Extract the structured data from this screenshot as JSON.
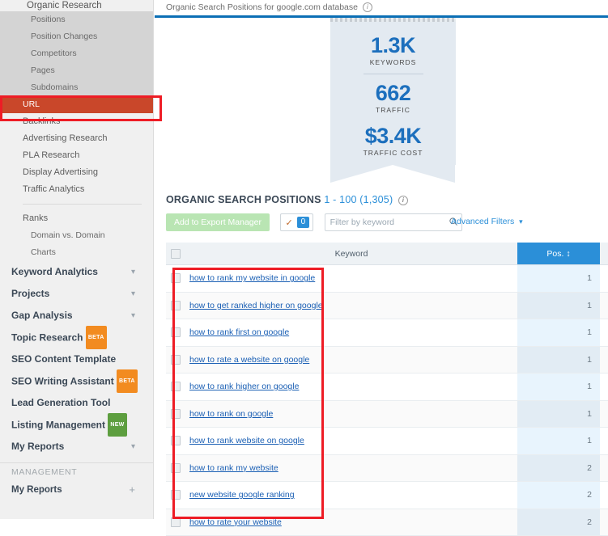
{
  "sidebar": {
    "top_item": "Organic Research",
    "submenu": [
      {
        "label": "Positions",
        "active": false
      },
      {
        "label": "Position Changes",
        "active": false
      },
      {
        "label": "Competitors",
        "active": false
      },
      {
        "label": "Pages",
        "active": false
      },
      {
        "label": "Subdomains",
        "active": false
      },
      {
        "label": "URL",
        "active": true
      }
    ],
    "items": [
      {
        "label": "Backlinks"
      },
      {
        "label": "Advertising Research"
      },
      {
        "label": "PLA Research"
      },
      {
        "label": "Display Advertising"
      },
      {
        "label": "Traffic Analytics"
      }
    ],
    "sub_items2": [
      {
        "label": "Ranks"
      },
      {
        "label": "Domain vs. Domain"
      },
      {
        "label": "Charts"
      }
    ],
    "groups": [
      {
        "label": "Keyword Analytics",
        "chevron": "chevron-down",
        "badge": null
      },
      {
        "label": "Projects",
        "chevron": "chevron-down",
        "badge": null
      },
      {
        "label": "Gap Analysis",
        "chevron": "chevron-down",
        "badge": null
      },
      {
        "label": "Topic Research",
        "chevron": null,
        "badge": "BETA",
        "badge_type": "beta"
      },
      {
        "label": "SEO Content Template",
        "chevron": null,
        "badge": null
      },
      {
        "label": "SEO Writing Assistant",
        "chevron": null,
        "badge": "BETA",
        "badge_type": "beta"
      },
      {
        "label": "Lead Generation Tool",
        "chevron": null,
        "badge": null
      },
      {
        "label": "Listing Management",
        "chevron": null,
        "badge": "NEW",
        "badge_type": "new"
      },
      {
        "label": "My Reports",
        "chevron": "chevron-down",
        "badge": null
      }
    ],
    "management_label": "MANAGEMENT",
    "management_item": "My Reports",
    "management_plus": "+"
  },
  "header": {
    "breadcrumb": "Organic Search Positions for google.com database",
    "info_icon": "i"
  },
  "stats_banner": {
    "items": [
      {
        "value": "1.3K",
        "label": "KEYWORDS"
      },
      {
        "value": "662",
        "label": "TRAFFIC"
      },
      {
        "value": "$3.4K",
        "label": "TRAFFIC COST"
      }
    ]
  },
  "section": {
    "title": "ORGANIC SEARCH POSITIONS",
    "count": "1 - 100 (1,305)"
  },
  "toolbar": {
    "export_label": "Add to Export Manager",
    "tick_icon": "check",
    "selected_count": "0",
    "filter_placeholder": "Filter by keyword",
    "filter_value": "",
    "advanced_filters": "Advanced Filters"
  },
  "table": {
    "columns": [
      "",
      "Keyword",
      "Pos. "
    ],
    "sort_indicator": "↕",
    "rows": [
      {
        "keyword": "how to rank my website in google",
        "pos": "1"
      },
      {
        "keyword": "how to get ranked higher on google",
        "pos": "1"
      },
      {
        "keyword": "how to rank first on google",
        "pos": "1"
      },
      {
        "keyword": "how to rate a website on google",
        "pos": "1"
      },
      {
        "keyword": "how to rank higher on google",
        "pos": "1"
      },
      {
        "keyword": "how to rank on google",
        "pos": "1"
      },
      {
        "keyword": "how to rank website on google",
        "pos": "1"
      },
      {
        "keyword": "how to rank my website",
        "pos": "2"
      },
      {
        "keyword": "new website google ranking",
        "pos": "2"
      },
      {
        "keyword": "how to rate your website",
        "pos": "2"
      }
    ]
  },
  "annotations": {
    "url_highlight": "red-box-around-url-menu-item",
    "keyword_highlight": "red-box-around-keyword-column"
  },
  "colors": {
    "accent_blue": "#2b8fd8",
    "active_orange": "#c9472a",
    "annotation_red": "#ee1c25",
    "link_blue": "#1a5fb4",
    "stat_blue": "#1c6fbd"
  }
}
